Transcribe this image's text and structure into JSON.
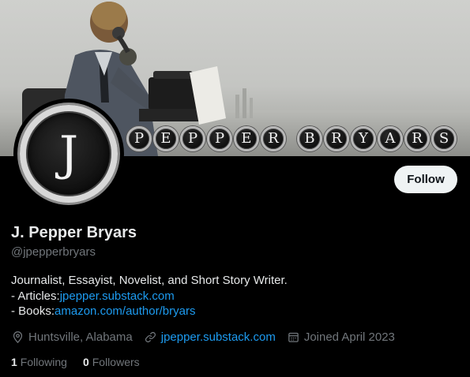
{
  "banner": {
    "keys_word1": [
      "P",
      "E",
      "P",
      "P",
      "E",
      "R"
    ],
    "keys_word2": [
      "B",
      "R",
      "Y",
      "A",
      "R",
      "S"
    ]
  },
  "avatar": {
    "letter": "J"
  },
  "follow_label": "Follow",
  "profile": {
    "display_name": "J. Pepper Bryars",
    "handle": "@jpepperbryars",
    "bio_line1": "Journalist, Essayist, Novelist, and Short Story Writer.",
    "articles_prefix": "- Articles:",
    "articles_link": "jpepper.substack.com",
    "books_prefix": "- Books:",
    "books_link": "amazon.com/author/bryars",
    "location": "Huntsville, Alabama",
    "website": "jpepper.substack.com",
    "joined": "Joined April 2023",
    "following_count": "1",
    "following_label": "Following",
    "followers_count": "0",
    "followers_label": "Followers"
  },
  "colors": {
    "background": "#000000",
    "text_primary": "#e7e9ea",
    "text_secondary": "#71767b",
    "link": "#1d9bf0",
    "follow_button_bg": "#eff3f4"
  },
  "icons": {
    "location": "location-pin-icon",
    "website": "link-icon",
    "joined": "calendar-icon"
  }
}
